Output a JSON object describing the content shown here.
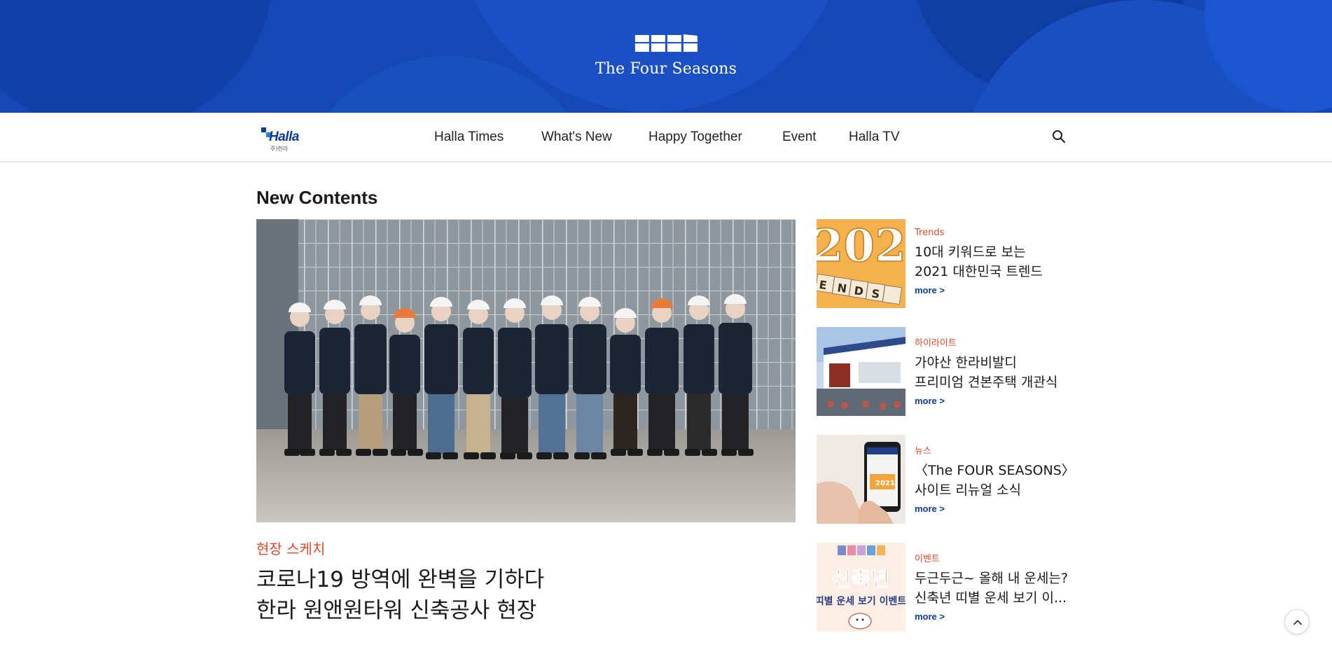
{
  "header": {
    "brand_name": "The Four Seasons",
    "logo_icon": "four-seasons-blocks-icon",
    "background_color": "#1446b4"
  },
  "nav": {
    "company_logo_text": "Halla",
    "company_logo_sub": "주)한라",
    "items": [
      {
        "label": "Halla Times"
      },
      {
        "label": "What's New"
      },
      {
        "label": "Happy Together"
      },
      {
        "label": "Event"
      },
      {
        "label": "Halla TV"
      }
    ],
    "search_icon": "search-icon"
  },
  "main": {
    "section_title": "New Contents",
    "featured": {
      "category": "현장 스케치",
      "title_lines": [
        "코로나19 방역에 완벽을 기하다",
        "한라 원앤원타워 신축공사 현장"
      ]
    },
    "side_items": [
      {
        "category": "Trends",
        "title_lines": [
          "10대 키워드로 보는",
          "2021 대한민국 트렌드"
        ],
        "more": "more >",
        "thumb_text": "2021 TRENDS"
      },
      {
        "category": "하이라이트",
        "title_lines": [
          "가야산 한라비발디",
          "프리미엄 견본주택 개관식"
        ],
        "more": "more >"
      },
      {
        "category": "뉴스",
        "title_lines": [
          "〈The FOUR SEASONS〉",
          "사이트 리뉴얼 소식"
        ],
        "more": "more >",
        "thumb_text": "2021"
      },
      {
        "category": "이벤트",
        "title_lines": [
          "두근두근~ 올해 내 운세는?",
          "신축년 띠별 운세 보기 이..."
        ],
        "more": "more >",
        "thumb_text": "신축년 띠별 운세 보기 이벤트"
      }
    ]
  },
  "colors": {
    "accent": "#e0492a",
    "link": "#0b3c96"
  },
  "scroll_top_icon": "chevron-up-icon"
}
